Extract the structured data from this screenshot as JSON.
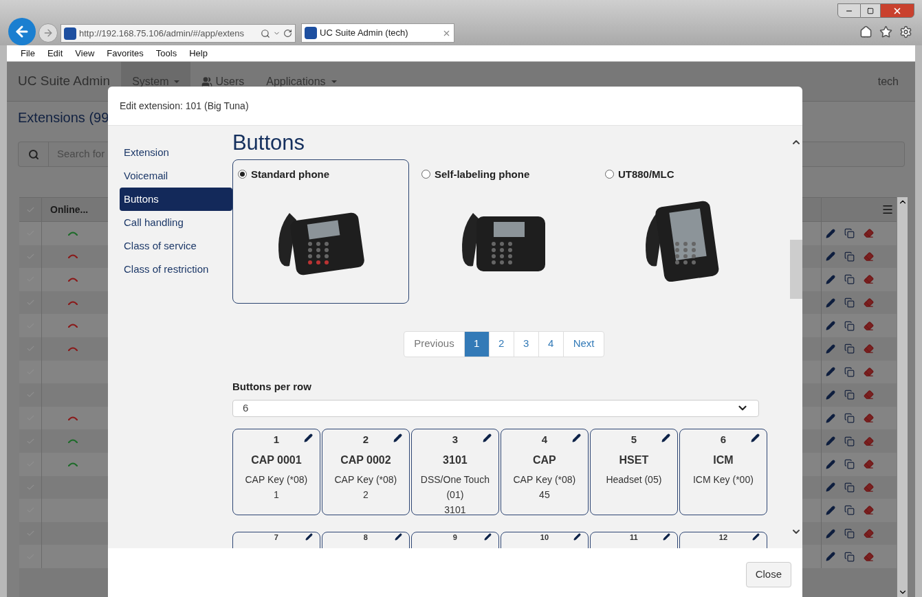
{
  "browser": {
    "address": "http://192.168.75.106/admin/#/app/extens",
    "tab": {
      "title": "UC Suite Admin (tech)"
    },
    "menu": [
      "File",
      "Edit",
      "View",
      "Favorites",
      "Tools",
      "Help"
    ]
  },
  "app": {
    "brand": "UC Suite Admin",
    "nav": [
      {
        "label": "System",
        "dropdown": true,
        "selected": true
      },
      {
        "label": "Users",
        "dropdown": false,
        "selected": false
      },
      {
        "label": "Applications",
        "dropdown": true,
        "selected": false
      }
    ],
    "user": "tech",
    "page_title": "Extensions (99",
    "search_placeholder": "Search for",
    "table": {
      "columns": [
        "Online..."
      ],
      "rows": [
        {
          "status_icon": true,
          "color": "#1e6b2a"
        },
        {
          "status_icon": true,
          "color": "#8a1a1a"
        },
        {
          "status_icon": true,
          "color": "#8a1a1a"
        },
        {
          "status_icon": true,
          "color": "#8a1a1a"
        },
        {
          "status_icon": true,
          "color": "#8a1a1a"
        },
        {
          "status_icon": true,
          "color": "#8a1a1a"
        },
        {
          "status_icon": false
        },
        {
          "status_icon": false
        },
        {
          "status_icon": true,
          "color": "#8a1a1a"
        },
        {
          "status_icon": true,
          "color": "#1e6b2a"
        },
        {
          "status_icon": true,
          "color": "#1e6b2a"
        },
        {
          "status_icon": false
        },
        {
          "status_icon": false
        },
        {
          "status_icon": false
        },
        {
          "status_icon": false
        }
      ]
    }
  },
  "modal": {
    "title": "Edit extension: 101 (Big Tuna)",
    "nav": [
      {
        "label": "Extension",
        "selected": false
      },
      {
        "label": "Voicemail",
        "selected": false
      },
      {
        "label": "Buttons",
        "selected": true
      },
      {
        "label": "Call handling",
        "selected": false
      },
      {
        "label": "Class of service",
        "selected": false
      },
      {
        "label": "Class of restriction",
        "selected": false
      }
    ],
    "heading": "Buttons",
    "phone_types": [
      {
        "label": "Standard phone",
        "selected": true
      },
      {
        "label": "Self-labeling phone",
        "selected": false
      },
      {
        "label": "UT880/MLC",
        "selected": false
      }
    ],
    "pagination": {
      "previous": "Previous",
      "next": "Next",
      "pages": [
        {
          "label": "1",
          "selected": true
        },
        {
          "label": "2",
          "selected": false
        },
        {
          "label": "3",
          "selected": false
        },
        {
          "label": "4",
          "selected": false
        }
      ]
    },
    "per_row": {
      "label": "Buttons per row",
      "value": "6"
    },
    "keys": [
      {
        "number": "1",
        "name": "CAP 0001",
        "type": "CAP Key (*08)",
        "value": "1"
      },
      {
        "number": "2",
        "name": "CAP 0002",
        "type": "CAP Key (*08)",
        "value": "2"
      },
      {
        "number": "3",
        "name": "3101",
        "type": "DSS/One Touch (01)",
        "value": "3101"
      },
      {
        "number": "4",
        "name": "CAP",
        "type": "CAP Key (*08)",
        "value": "45"
      },
      {
        "number": "5",
        "name": "HSET",
        "type": "Headset (05)"
      },
      {
        "number": "6",
        "name": "ICM",
        "type": "ICM Key (*00)"
      }
    ],
    "more_keys": [
      {
        "number": "7"
      },
      {
        "number": "8"
      },
      {
        "number": "9"
      },
      {
        "number": "10"
      },
      {
        "number": "11"
      },
      {
        "number": "12"
      }
    ],
    "close": "Close"
  }
}
